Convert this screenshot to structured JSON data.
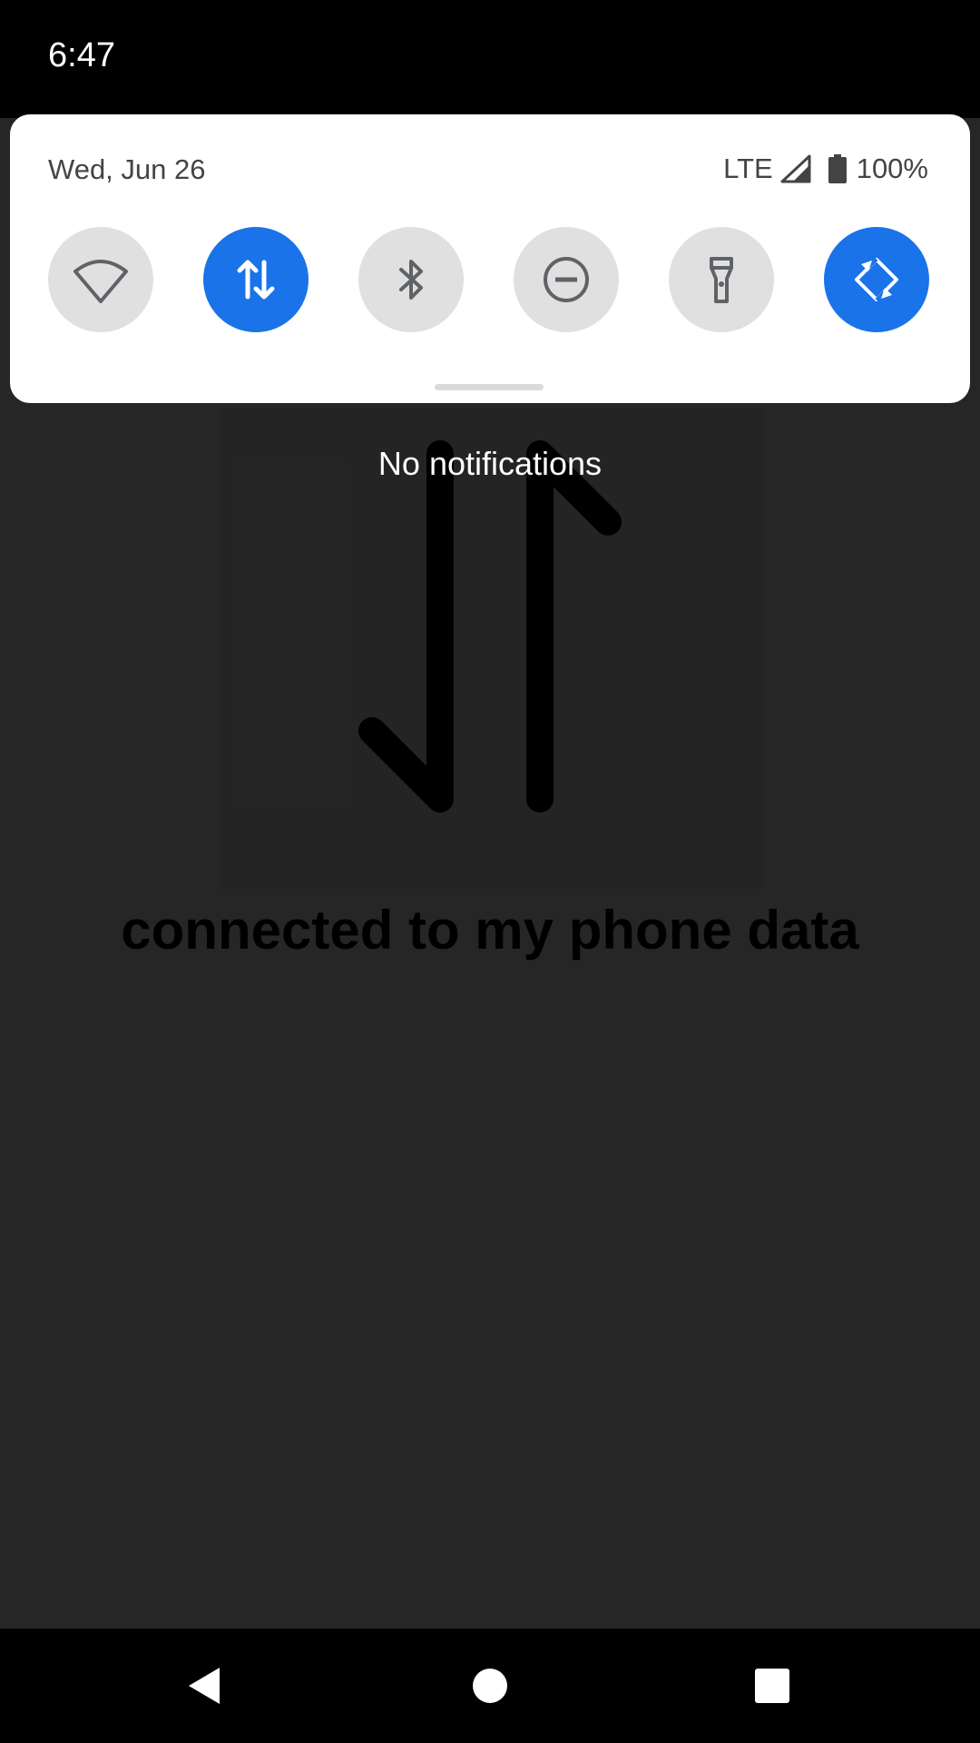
{
  "status_bar": {
    "time": "6:47"
  },
  "quick_settings": {
    "date": "Wed, Jun 26",
    "network": "LTE",
    "battery": "100%",
    "tiles": [
      {
        "name": "wifi",
        "icon": "wifi-icon",
        "active": false
      },
      {
        "name": "mobile-data",
        "icon": "data-arrows-icon",
        "active": true
      },
      {
        "name": "bluetooth",
        "icon": "bluetooth-icon",
        "active": false
      },
      {
        "name": "do-not-disturb",
        "icon": "dnd-icon",
        "active": false
      },
      {
        "name": "flashlight",
        "icon": "flashlight-icon",
        "active": false
      },
      {
        "name": "auto-rotate",
        "icon": "rotate-icon",
        "active": true
      }
    ],
    "active_color": "#1a73e8"
  },
  "notifications": {
    "empty_text": "No notifications"
  },
  "background": {
    "caption": "connected to my phone data"
  },
  "nav_bar": {
    "buttons": [
      "back",
      "home",
      "recents"
    ]
  }
}
